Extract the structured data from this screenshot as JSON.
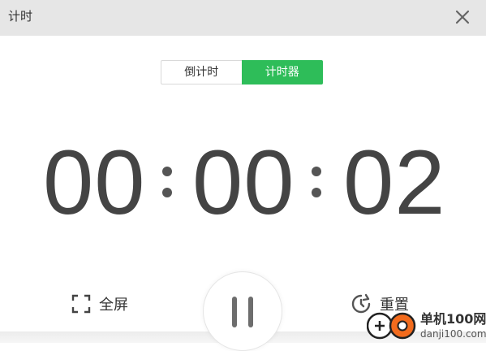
{
  "window": {
    "title": "计时"
  },
  "tabs": [
    {
      "label": "倒计时",
      "active": false
    },
    {
      "label": "计时器",
      "active": true
    }
  ],
  "timer": {
    "hours": "00",
    "minutes": "00",
    "seconds": "02"
  },
  "controls": {
    "fullscreen_label": "全屏",
    "reset_label": "重置"
  },
  "watermark": {
    "brand": "单机100网",
    "url": "danji100.com"
  },
  "colors": {
    "accent": "#2ebd59",
    "titlebar": "#e6e6e6",
    "digits": "#444444"
  },
  "icons": {
    "close": "close-icon",
    "fullscreen": "fullscreen-icon",
    "reset": "reset-icon",
    "pause": "pause-icon"
  }
}
